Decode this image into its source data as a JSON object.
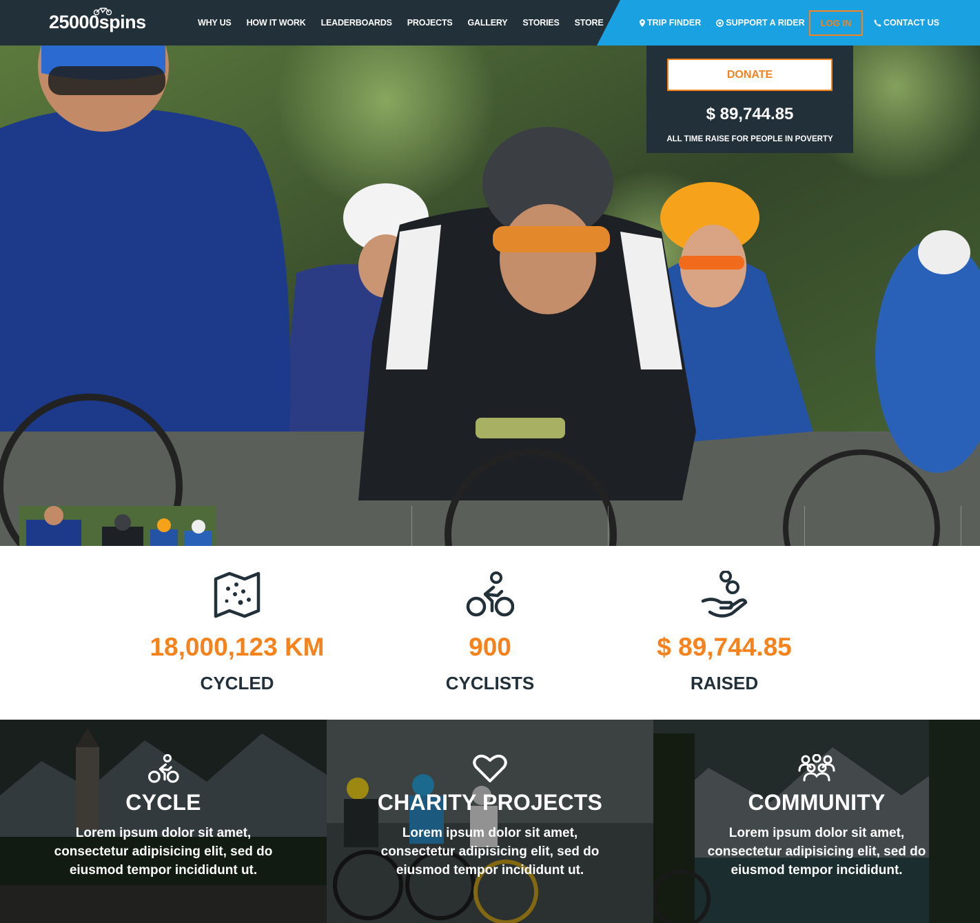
{
  "brand": {
    "logo_text": "25000spins"
  },
  "nav": {
    "items": [
      "WHY US",
      "HOW IT WORK",
      "LEADERBOARDS",
      "PROJECTS",
      "GALLERY",
      "STORIES",
      "STORE"
    ],
    "trip_finder": "TRIP FINDER",
    "support_rider": "SUPPORT A RIDER",
    "login": "LOG IN",
    "contact": "CONTACT US"
  },
  "donate": {
    "button": "DONATE",
    "amount": "$ 89,744.85",
    "caption": "ALL TIME RAISE FOR PEOPLE IN POVERTY"
  },
  "stats": [
    {
      "value": "18,000,123 KM",
      "label": "CYCLED",
      "icon": "map-icon"
    },
    {
      "value": "900",
      "label": "CYCLISTS",
      "icon": "cyclist-icon"
    },
    {
      "value": "$ 89,744.85",
      "label": "RAISED",
      "icon": "donation-hand-icon"
    }
  ],
  "features": [
    {
      "title": "CYCLE",
      "text": "Lorem ipsum dolor sit amet, consectetur adipisicing elit, sed do eiusmod tempor incididunt ut.",
      "icon": "cyclist-icon"
    },
    {
      "title": "CHARITY PROJECTS",
      "text": "Lorem ipsum dolor sit amet, consectetur adipisicing elit, sed do eiusmod tempor incididunt ut.",
      "icon": "heart-icon"
    },
    {
      "title": "COMMUNITY",
      "text": "Lorem ipsum dolor sit amet, consectetur adipisicing elit, sed do eiusmod tempor incididunt.",
      "icon": "people-group-icon"
    }
  ],
  "colors": {
    "navy": "#22303a",
    "blue": "#1aa1e1",
    "orange": "#f7821b"
  }
}
